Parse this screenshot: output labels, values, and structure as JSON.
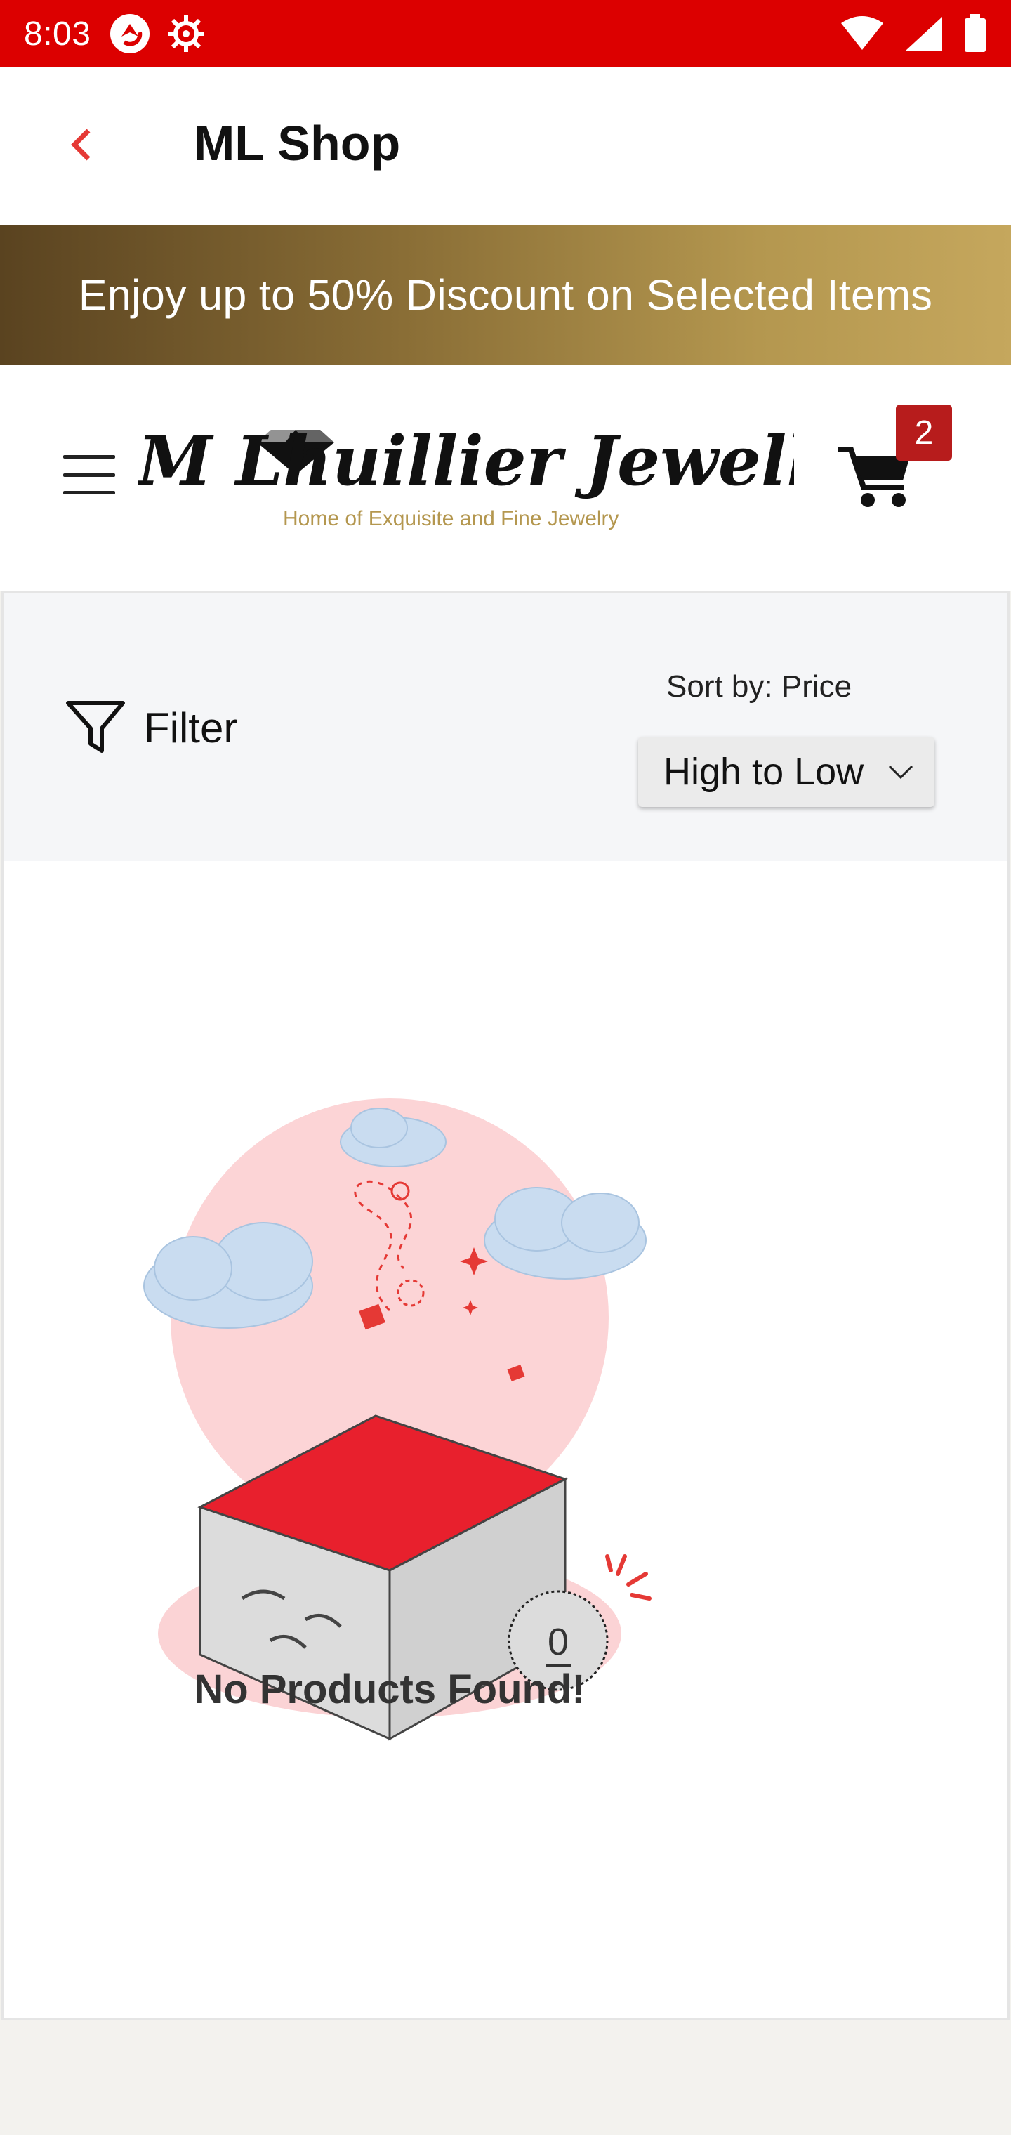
{
  "status_bar": {
    "time": "8:03",
    "icons": [
      "app-icon",
      "settings-icon",
      "wifi-icon",
      "signal-icon",
      "battery-icon"
    ]
  },
  "app_bar": {
    "title": "ML Shop",
    "back_icon": "chevron-left-icon"
  },
  "promo": {
    "text": "Enjoy up to 50% Discount on Selected Items"
  },
  "store_header": {
    "logo_title": "M Lhuillier Jewellers",
    "logo_tagline": "Home of Exquisite and Fine Jewelry",
    "cart_count": "2"
  },
  "toolbar": {
    "filter_label": "Filter",
    "sort_label": "Sort by: Price",
    "sort_value": "High to Low"
  },
  "empty_state": {
    "message": "No Products Found!",
    "badge_number": "0"
  },
  "colors": {
    "status_bar": "#dc0000",
    "accent_red": "#e53935",
    "badge": "#b71c1c",
    "gold": "#c5a75d"
  }
}
